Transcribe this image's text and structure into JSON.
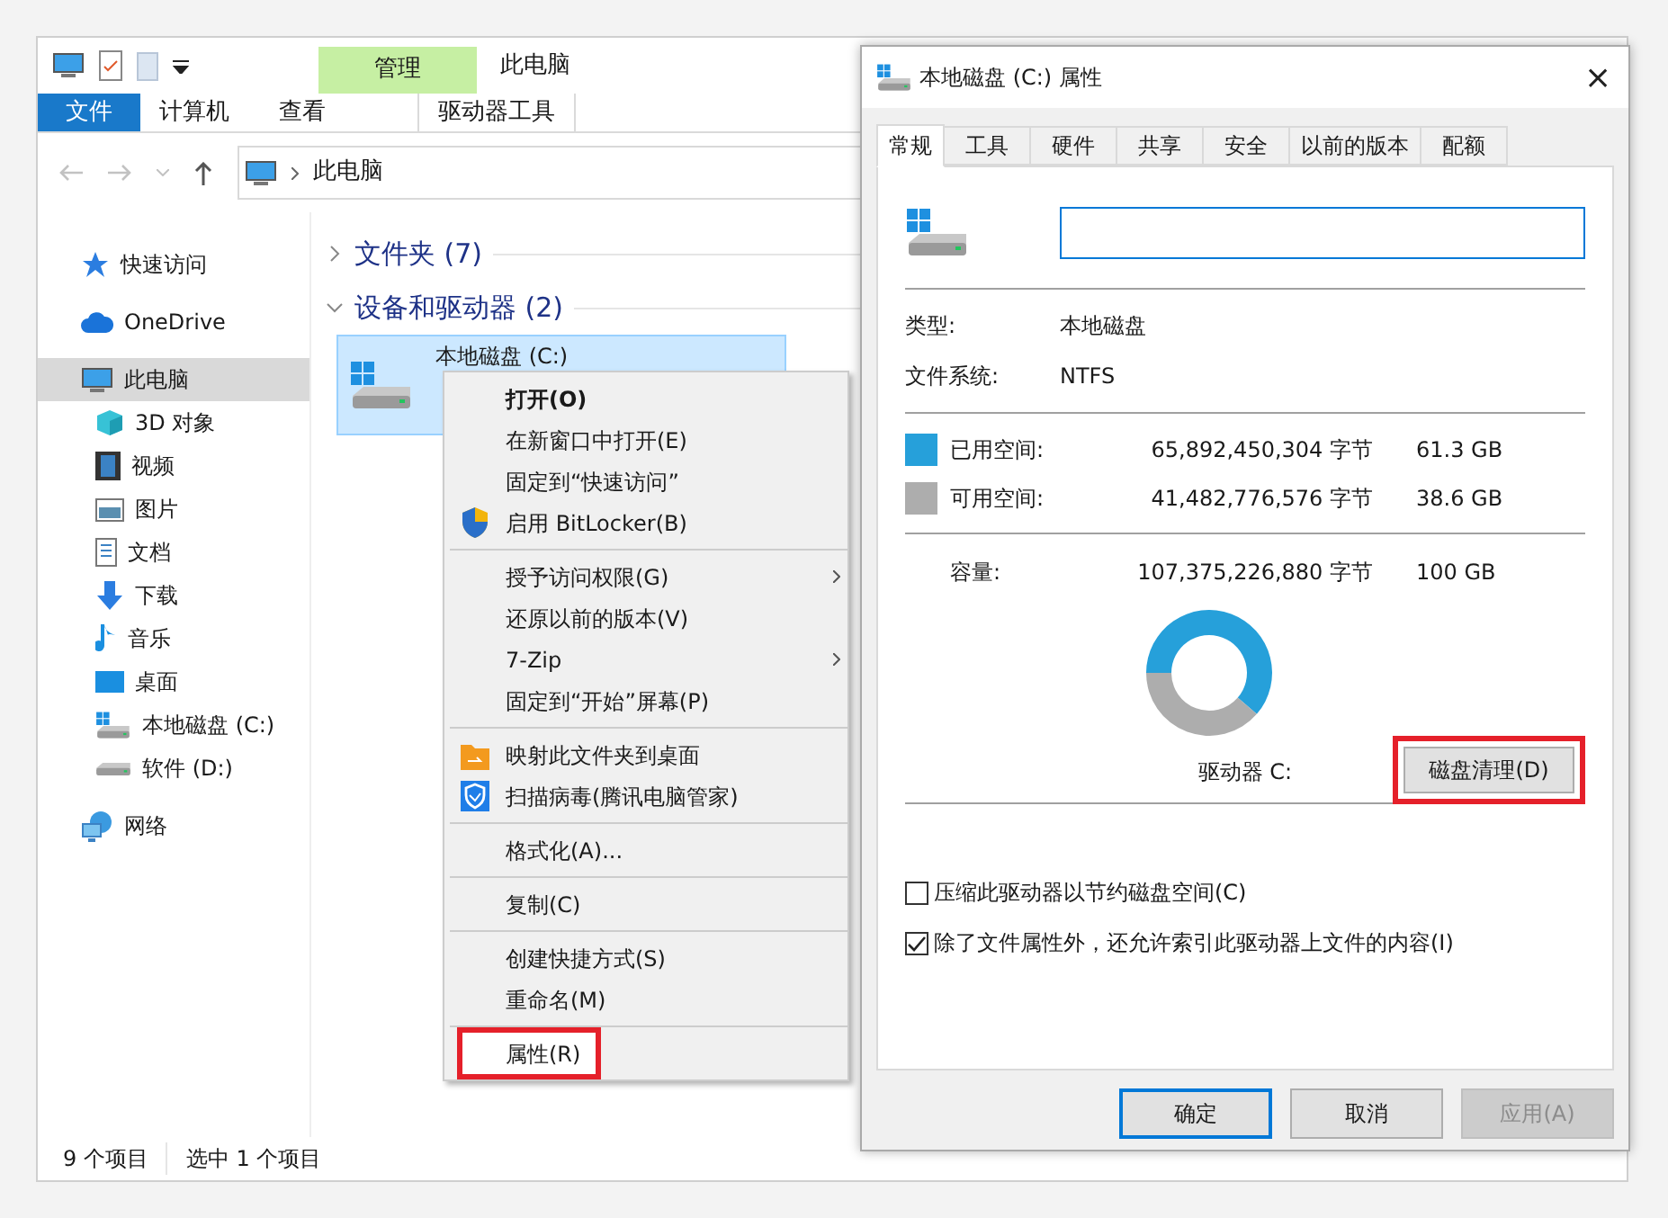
{
  "explorer": {
    "title": "此电脑",
    "context_tab": "管理",
    "ribbon_tabs": [
      {
        "label": "文件",
        "kind": "file"
      },
      {
        "label": "计算机",
        "kind": "tab"
      },
      {
        "label": "查看",
        "kind": "tab"
      },
      {
        "label": "驱动器工具",
        "kind": "contextual"
      }
    ],
    "address": "此电脑",
    "nav": [
      {
        "label": "快速访问",
        "selected": false
      },
      {
        "label": "OneDrive",
        "selected": false
      },
      {
        "label": "此电脑",
        "selected": true,
        "children": [
          {
            "label": "3D 对象",
            "selected": false
          },
          {
            "label": "视频",
            "selected": false
          },
          {
            "label": "图片",
            "selected": false
          },
          {
            "label": "文档",
            "selected": false
          },
          {
            "label": "下载",
            "selected": false
          },
          {
            "label": "音乐",
            "selected": false
          },
          {
            "label": "桌面",
            "selected": false
          },
          {
            "label": "本地磁盘 (C:)",
            "selected": false
          },
          {
            "label": "软件 (D:)",
            "selected": false
          }
        ]
      },
      {
        "label": "网络",
        "selected": false
      }
    ],
    "groups": [
      {
        "label": "文件夹 (7)",
        "expanded": false
      },
      {
        "label": "设备和驱动器 (2)",
        "expanded": true
      }
    ],
    "drive": {
      "label": "本地磁盘 (C:)",
      "selected": true
    },
    "status_bar": [
      "9 个项目",
      "选中 1 个项目"
    ]
  },
  "context_menu": [
    {
      "kind": "item",
      "label": "打开(O)",
      "bold": true
    },
    {
      "kind": "item",
      "label": "在新窗口中打开(E)"
    },
    {
      "kind": "item",
      "label": "固定到“快速访问”"
    },
    {
      "kind": "item",
      "label": "启用 BitLocker(B)",
      "icon": true
    },
    {
      "kind": "separator"
    },
    {
      "kind": "item",
      "label": "授予访问权限(G)",
      "submenu": true
    },
    {
      "kind": "item",
      "label": "还原以前的版本(V)"
    },
    {
      "kind": "item",
      "label": "7-Zip",
      "submenu": true
    },
    {
      "kind": "item",
      "label": "固定到“开始”屏幕(P)"
    },
    {
      "kind": "separator"
    },
    {
      "kind": "item",
      "label": "映射此文件夹到桌面",
      "icon": true
    },
    {
      "kind": "item",
      "label": "扫描病毒(腾讯电脑管家)",
      "icon": true
    },
    {
      "kind": "separator"
    },
    {
      "kind": "item",
      "label": "格式化(A)..."
    },
    {
      "kind": "separator"
    },
    {
      "kind": "item",
      "label": "复制(C)"
    },
    {
      "kind": "separator"
    },
    {
      "kind": "item",
      "label": "创建快捷方式(S)"
    },
    {
      "kind": "item",
      "label": "重命名(M)"
    },
    {
      "kind": "separator"
    },
    {
      "kind": "item",
      "label": "属性(R)",
      "highlighted": true
    }
  ],
  "dialog": {
    "title": "本地磁盘 (C:) 属性",
    "close": "×",
    "tabs": [
      {
        "label": "常规",
        "selected": true
      },
      {
        "label": "工具",
        "selected": false
      },
      {
        "label": "硬件",
        "selected": false
      },
      {
        "label": "共享",
        "selected": false
      },
      {
        "label": "安全",
        "selected": false
      },
      {
        "label": "以前的版本",
        "selected": false
      },
      {
        "label": "配额",
        "selected": false
      }
    ],
    "info": [
      {
        "label": "类型:",
        "value": "本地磁盘"
      },
      {
        "label": "文件系统:",
        "value": "NTFS"
      }
    ],
    "space": [
      {
        "label": "已用空间:",
        "bytes": "65,892,450,304 字节",
        "size": "61.3 GB",
        "color": "#26a0da"
      },
      {
        "label": "可用空间:",
        "bytes": "41,482,776,576 字节",
        "size": "38.6 GB",
        "color": "#adadad"
      }
    ],
    "capacity": {
      "label": "容量:",
      "bytes": "107,375,226,880 字节",
      "size": "100 GB"
    },
    "chart_data": {
      "type": "donut",
      "values": [
        61.3,
        38.6
      ]
    },
    "drive_label": "驱动器 C:",
    "cleanup_button": {
      "label": "磁盘清理(D)",
      "highlighted": true
    },
    "options": [
      {
        "label": "压缩此驱动器以节约磁盘空间(C)",
        "checked": false
      },
      {
        "label": "除了文件属性外，还允许索引此驱动器上文件的内容(I)",
        "checked": true
      }
    ],
    "buttons": [
      {
        "label": "确定",
        "kind": "default"
      },
      {
        "label": "取消",
        "kind": "normal"
      },
      {
        "label": "应用(A)",
        "kind": "disabled"
      }
    ]
  }
}
